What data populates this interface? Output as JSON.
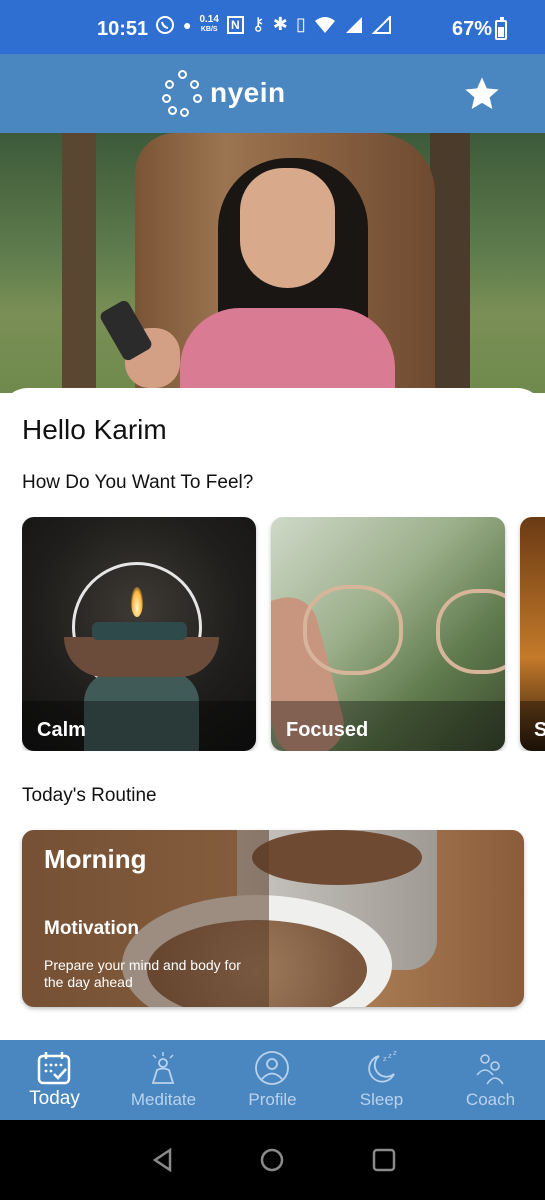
{
  "status_bar": {
    "time": "10:51",
    "network_speed_value": "0.14",
    "network_speed_unit": "KB/S",
    "battery": "67%"
  },
  "app_bar": {
    "logo_text": "nyein",
    "favorite_icon": "star-icon"
  },
  "home": {
    "greeting": "Hello Karim",
    "feel_title": "How Do You Want To Feel?",
    "feel_cards": [
      {
        "label": "Calm"
      },
      {
        "label": "Focused"
      },
      {
        "label": "S"
      }
    ],
    "routine_title": "Today's Routine",
    "routine": {
      "title": "Morning",
      "subtitle": "Motivation",
      "description": "Prepare your mind and body for the day ahead"
    }
  },
  "tabs": [
    {
      "label": "Today",
      "icon": "calendar-icon",
      "active": true
    },
    {
      "label": "Meditate",
      "icon": "meditate-icon",
      "active": false
    },
    {
      "label": "Profile",
      "icon": "profile-icon",
      "active": false
    },
    {
      "label": "Sleep",
      "icon": "moon-icon",
      "active": false
    },
    {
      "label": "Coach",
      "icon": "coach-icon",
      "active": false
    }
  ],
  "colors": {
    "status_bar": "#2f6fd1",
    "app_bar": "#4a86c0",
    "tab_active": "#ffffff",
    "tab_inactive": "#b9d3ee"
  }
}
